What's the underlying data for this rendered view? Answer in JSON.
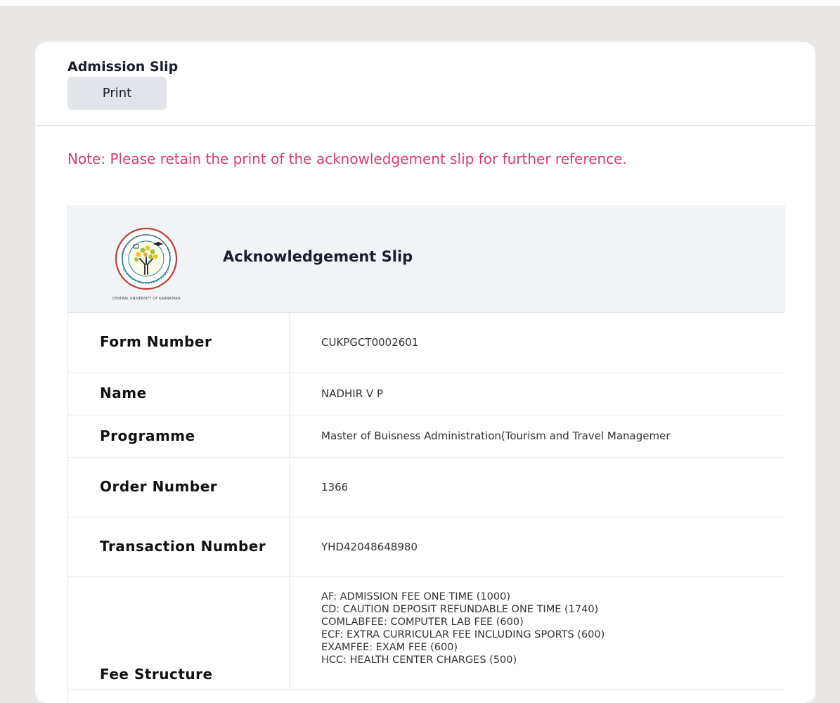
{
  "card": {
    "title": "Admission Slip",
    "print_label": "Print"
  },
  "note": "Note: Please retain the print of the acknowledgement slip for further reference.",
  "slip": {
    "title": "Acknowledgement Slip",
    "logo": {
      "icon": "university-seal-logo",
      "caption": "CENTRAL UNIVERSITY OF KARNATAKA"
    },
    "rows": [
      {
        "label": "Form Number",
        "value": "CUKPGCT0002601"
      },
      {
        "label": "Name",
        "value": "NADHIR V P"
      },
      {
        "label": "Programme",
        "value": "Master of Buisness Administration(Tourism and Travel Managemer"
      },
      {
        "label": "Order Number",
        "value": "1366"
      },
      {
        "label": "Transaction Number",
        "value": "YHD42048648980"
      }
    ],
    "fee": {
      "label": "Fee Structure",
      "items": [
        "AF: ADMISSION FEE ONE TIME (1000)",
        "CD: CAUTION DEPOSIT REFUNDABLE ONE TIME (1740)",
        "COMLABFEE: COMPUTER LAB FEE (600)",
        "ECF: EXTRA CURRICULAR FEE INCLUDING SPORTS (600)",
        "EXAMFEE: EXAM FEE (600)",
        "HCC: HEALTH CENTER CHARGES (500)"
      ]
    }
  },
  "colors": {
    "note": "#e0386d",
    "background": "#e9e8e6",
    "slip_header_bg": "#f1f4f7",
    "seal_red": "#c23a3a",
    "seal_teal": "#1f7e86"
  }
}
